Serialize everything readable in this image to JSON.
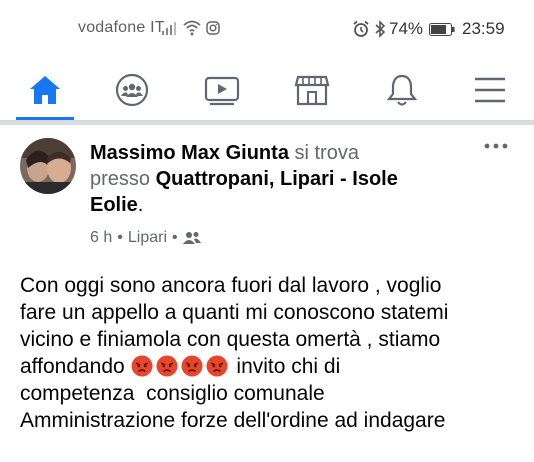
{
  "status": {
    "carrier": "vodafone IT",
    "battery": "74%",
    "time": "23:59"
  },
  "nav": {
    "items": [
      {
        "name": "home",
        "active": true
      },
      {
        "name": "groups"
      },
      {
        "name": "watch"
      },
      {
        "name": "marketplace"
      },
      {
        "name": "notifications"
      },
      {
        "name": "menu"
      }
    ]
  },
  "post": {
    "author": "Massimo Max Giunta",
    "action_1": " si trova",
    "action_2": "presso ",
    "place": "Quattropani, Lipari - Isole",
    "place_2": "Eolie",
    "period": ".",
    "time": "6 h",
    "dot1": "•",
    "location": "Lipari",
    "dot2": "•",
    "text_1": "Con oggi sono ancora fuori dal lavoro , voglio\nfare un appello a quanti mi conoscono statemi\nvicino e finiamola con questa omertà , stiamo\naffondando ",
    "text_2": " invito chi di\ncompetenza  consiglio comunale\nAmministrazione forze dell'ordine ad indagare",
    "accent_color": "#1877f2"
  }
}
